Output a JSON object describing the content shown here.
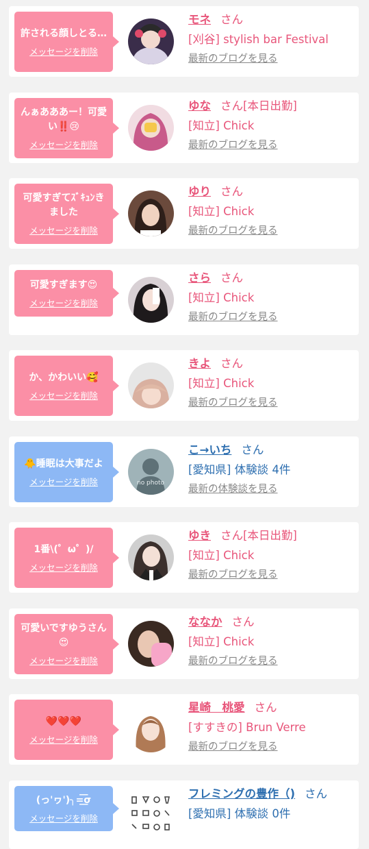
{
  "delete_label": "メッセージを削除",
  "cards": [
    {
      "message": "許される顔しとる…",
      "name": "モネ",
      "suffix": "さん",
      "location": "[刈谷] stylish bar Festival",
      "link": "最新のブログを見る",
      "theme": "pink",
      "avatar": "photo-avatar"
    },
    {
      "message": "んぁあああー！可愛い‼️😢",
      "name": "ゆな",
      "suffix": "さん[本日出勤]",
      "location": "[知立] Chick",
      "link": "最新のブログを見る",
      "theme": "pink",
      "avatar": "photo-avatar"
    },
    {
      "message": "可愛すぎてｽﾞｷｭﾝきました",
      "name": "ゆり",
      "suffix": "さん",
      "location": "[知立] Chick",
      "link": "最新のブログを見る",
      "theme": "pink",
      "avatar": "photo-avatar"
    },
    {
      "message": "可愛すぎます😍",
      "name": "さら",
      "suffix": "さん",
      "location": "[知立] Chick",
      "link": "最新のブログを見る",
      "theme": "pink",
      "avatar": "photo-avatar"
    },
    {
      "message": "か、かわいい🥰",
      "name": "きよ",
      "suffix": "さん",
      "location": "[知立] Chick",
      "link": "最新のブログを見る",
      "theme": "pink",
      "avatar": "photo-avatar"
    },
    {
      "message": "🐥睡眠は大事だよ",
      "name": "こ→いち",
      "suffix": "さん",
      "location": "[愛知県] 体験談 4件",
      "link": "最新の体験談を見る",
      "theme": "blue",
      "avatar": "no-photo-avatar",
      "avatar_text": "no photo"
    },
    {
      "message": "1番\\(゜ω゜)/",
      "name": "ゆき",
      "suffix": "さん[本日出勤]",
      "location": "[知立] Chick",
      "link": "最新のブログを見る",
      "theme": "pink",
      "avatar": "photo-avatar"
    },
    {
      "message": "可愛いですゆうさん😍",
      "name": "ななか",
      "suffix": "さん",
      "location": "[知立] Chick",
      "link": "最新のブログを見る",
      "theme": "pink",
      "avatar": "photo-avatar"
    },
    {
      "message": "❤️❤️❤️",
      "name": "星崎　桃愛",
      "suffix": "さん",
      "location": "[すすきの] Brun Verre",
      "link": "最新のブログを見る",
      "theme": "pink",
      "avatar": "photo-avatar"
    },
    {
      "message": "(っ'ヮ')╮=͟͟͞͞σ",
      "name": "フレミングの豊作（)",
      "suffix": "さん",
      "location": "[愛知県] 体験談 0件",
      "link": "",
      "theme": "blue",
      "avatar": "icon-grid-avatar"
    }
  ],
  "colors": {
    "pink_bubble": "#fb8fa6",
    "blue_bubble": "#8db8f5",
    "pink_text": "#e8557a",
    "blue_text": "#2e6fb0",
    "link_gray": "#888888"
  }
}
